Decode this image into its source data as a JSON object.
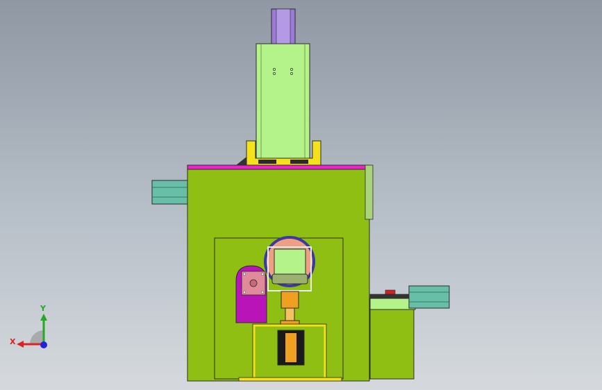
{
  "viewport": {
    "background_top": "#8f98a3",
    "background_bottom": "#d5d9dd"
  },
  "colors": {
    "frame_green": "#8fbf13",
    "column_green": "#b4f28a",
    "motor_purple": "#9b79d6",
    "top_plate_magenta": "#ee22cc",
    "rail_teal": "#66bfa6",
    "bracket_yellow": "#f4e11c",
    "drum_pink": "#f0a080",
    "drum_ring_blue": "#3a3aa0",
    "plate_magenta": "#b814b8",
    "cylinder_orange": "#f0a020",
    "cylinder_black": "#1a1a1a",
    "outline": "#2b2b2b"
  },
  "triad": {
    "y_label": "Y",
    "x_label": "X",
    "y_color": "#22aa22",
    "x_color": "#dd2222",
    "z_color": "#2222dd"
  },
  "icons": [
    "coordinate-triad-icon"
  ]
}
